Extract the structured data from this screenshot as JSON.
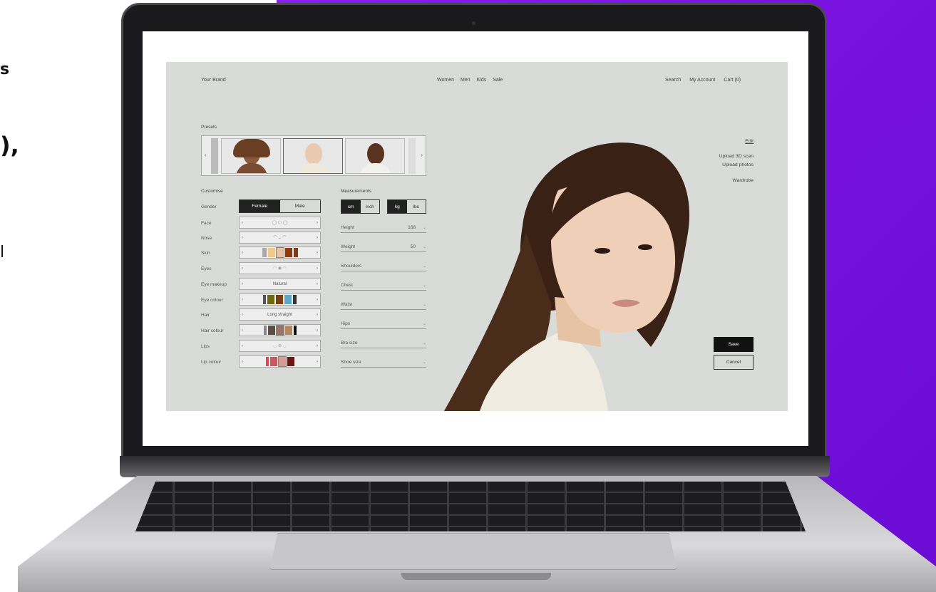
{
  "side_text": [
    "s",
    "),",
    "l"
  ],
  "nav": {
    "brand": "Your Brand",
    "links": [
      "Women",
      "Men",
      "Kids",
      "Sale"
    ],
    "right": [
      "Search",
      "My Account",
      "Cart (0)"
    ]
  },
  "presets": {
    "title": "Presets"
  },
  "customise": {
    "title": "Customise",
    "gender": {
      "label": "Gender",
      "options": [
        "Female",
        "Male"
      ],
      "selected": "Female"
    },
    "rows": [
      {
        "label": "Face"
      },
      {
        "label": "Nose"
      },
      {
        "label": "Skin"
      },
      {
        "label": "Eyes"
      },
      {
        "label": "Eye makeup",
        "value": "Natural"
      },
      {
        "label": "Eye colour"
      },
      {
        "label": "Hair",
        "value": "Long straight"
      },
      {
        "label": "Hair colour"
      },
      {
        "label": "Lips"
      },
      {
        "label": "Lip colour"
      }
    ],
    "swatches": {
      "skin": [
        "#f3c98a",
        "#e7c3a6",
        "#8a3a10",
        "#7a3e18"
      ],
      "eye_colour": [
        "#6d6a10",
        "#7a4011",
        "#5da7c7",
        "#333333"
      ],
      "hair_colour": [
        "#5a4f45",
        "#9a7565",
        "#b7885f",
        "#111111"
      ],
      "lip_colour": [
        "#e0464f",
        "#c9595f",
        "#d99a8d",
        "#6d1616"
      ]
    }
  },
  "measurements": {
    "title": "Measurements",
    "length_units": [
      "cm",
      "inch"
    ],
    "weight_units": [
      "kg",
      "lbs"
    ],
    "rows": [
      {
        "label": "Height",
        "value": "168"
      },
      {
        "label": "Weight",
        "value": "50"
      },
      {
        "label": "Shoulders",
        "value": ""
      },
      {
        "label": "Chest",
        "value": ""
      },
      {
        "label": "Waist",
        "value": ""
      },
      {
        "label": "Hips",
        "value": ""
      },
      {
        "label": "Bra size",
        "value": ""
      },
      {
        "label": "Shoe size",
        "value": ""
      }
    ]
  },
  "right_links": {
    "edit": "Edit",
    "upload_scan": "Upload 3D scan",
    "upload_photos": "Upload photos",
    "wardrobe": "Wardrobe"
  },
  "actions": {
    "save": "Save",
    "cancel": "Cancel"
  },
  "colors": {
    "accent": "#7a13e0",
    "app_bg": "#d9dbd9"
  }
}
